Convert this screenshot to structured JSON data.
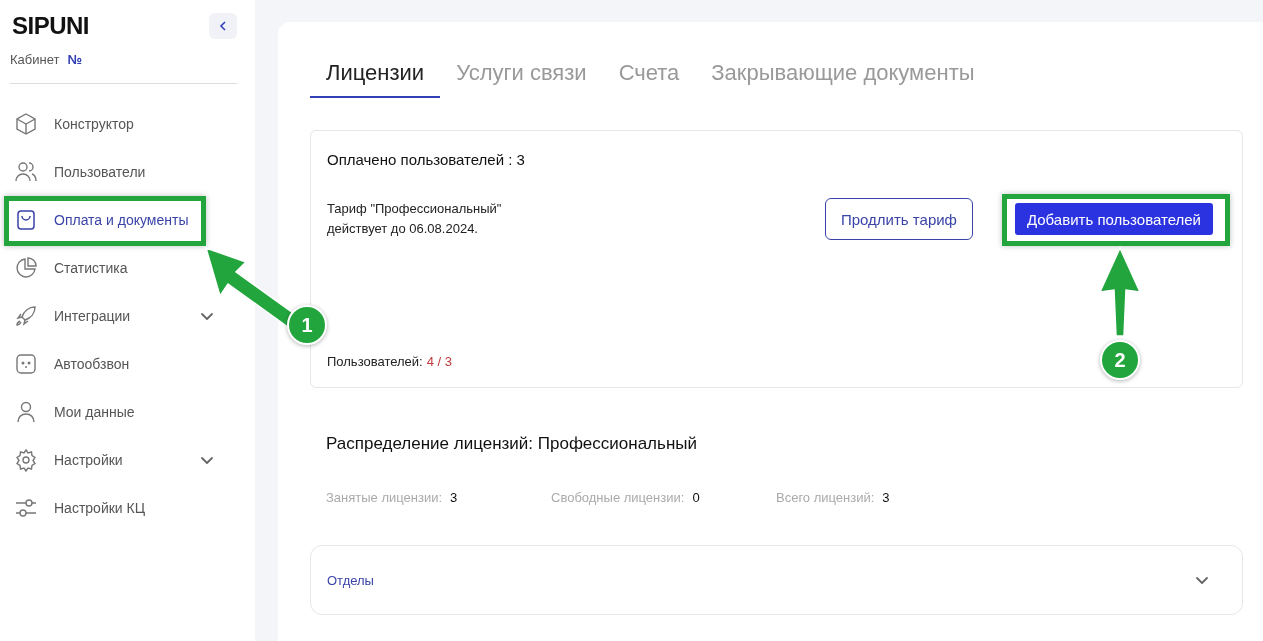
{
  "sidebar": {
    "logo": "SIPUNI",
    "cabinet_label": "Кабинет",
    "cabinet_number": "№",
    "items": [
      {
        "label": "Конструктор",
        "selected": false,
        "expandable": false
      },
      {
        "label": "Пользователи",
        "selected": false,
        "expandable": false
      },
      {
        "label": "Оплата и документы",
        "selected": true,
        "expandable": false
      },
      {
        "label": "Статистика",
        "selected": false,
        "expandable": false
      },
      {
        "label": "Интеграции",
        "selected": false,
        "expandable": true
      },
      {
        "label": "Автообзвон",
        "selected": false,
        "expandable": false
      },
      {
        "label": "Мои данные",
        "selected": false,
        "expandable": false
      },
      {
        "label": "Настройки",
        "selected": false,
        "expandable": true
      },
      {
        "label": "Настройки КЦ",
        "selected": false,
        "expandable": false
      }
    ]
  },
  "tabs": [
    {
      "label": "Лицензии",
      "selected": true
    },
    {
      "label": "Услуги связи",
      "selected": false
    },
    {
      "label": "Счета",
      "selected": false
    },
    {
      "label": "Закрывающие документы",
      "selected": false
    }
  ],
  "license_card": {
    "paid_users": "Оплачено пользователей : 3",
    "tariff_line_1": "Тариф \"Профессиональный\"",
    "tariff_line_2": "действует до 06.08.2024.",
    "extend_button": "Продлить тариф",
    "add_users_button": "Добавить пользователей",
    "users_label": "Пользователей:",
    "users_value": "4 / 3"
  },
  "distribution": {
    "title": "Распределение лицензий: Профессиональный",
    "stats": [
      {
        "label": "Занятые лицензии:",
        "value": "3"
      },
      {
        "label": "Свободные лицензии:",
        "value": "0"
      },
      {
        "label": "Всего лицензий:",
        "value": "3"
      }
    ]
  },
  "accordion": {
    "label": "Отделы",
    "expanded": false
  },
  "annotations": [
    {
      "number": "1"
    },
    {
      "number": "2"
    }
  ]
}
